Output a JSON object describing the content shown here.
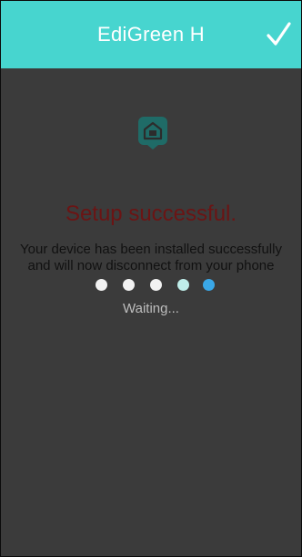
{
  "header": {
    "title": "EdiGreen H",
    "confirm_icon": "check-icon",
    "background": "#47d5cf"
  },
  "main": {
    "device_icon": "home-plug-icon",
    "title": "Setup successful.",
    "title_color": "#6b1414",
    "message": "Your device has been installed successfully and will now disconnect from your phone",
    "status": "Waiting..."
  },
  "colors": {
    "background": "#3b3b3b",
    "accent": "#47d5cf"
  }
}
